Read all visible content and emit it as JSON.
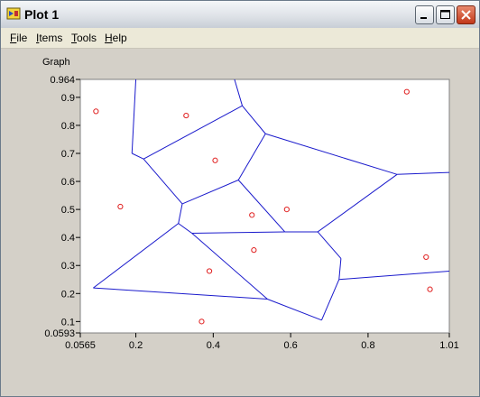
{
  "window": {
    "title": "Plot 1",
    "icon": "labview-vi-icon"
  },
  "menubar": [
    {
      "label": "File",
      "underline": "F",
      "rest": "ile"
    },
    {
      "label": "Items",
      "underline": "I",
      "rest": "tems"
    },
    {
      "label": "Tools",
      "underline": "T",
      "rest": "ools"
    },
    {
      "label": "Help",
      "underline": "H",
      "rest": "elp"
    }
  ],
  "graph": {
    "label": "Graph"
  },
  "colors": {
    "edges": "#1a1acc",
    "points": "#e02020",
    "plot_bg": "#ffffff"
  },
  "chart_data": {
    "type": "scatter",
    "title": "",
    "xlabel": "",
    "ylabel": "",
    "xlim": [
      0.0565,
      1.01
    ],
    "ylim": [
      0.0593,
      0.964
    ],
    "x_ticks": [
      "0.0565",
      "0.2",
      "0.4",
      "0.6",
      "0.8",
      "1.01"
    ],
    "x_tick_values": [
      0.0565,
      0.2,
      0.4,
      0.6,
      0.8,
      1.01
    ],
    "y_ticks": [
      "0.964",
      "0.9",
      "0.8",
      "0.7",
      "0.6",
      "0.5",
      "0.4",
      "0.3",
      "0.2",
      "0.1",
      "0.0593"
    ],
    "y_tick_values": [
      0.964,
      0.9,
      0.8,
      0.7,
      0.6,
      0.5,
      0.4,
      0.3,
      0.2,
      0.1,
      0.0593
    ],
    "grid": false,
    "series": [
      {
        "kind": "points",
        "x": [
          0.097,
          0.33,
          0.405,
          0.16,
          0.5,
          0.59,
          0.505,
          0.39,
          0.37,
          0.9,
          0.95,
          0.96
        ],
        "y": [
          0.85,
          0.835,
          0.675,
          0.51,
          0.48,
          0.5,
          0.355,
          0.28,
          0.1,
          0.92,
          0.33,
          0.215
        ]
      },
      {
        "kind": "voronoi-edges",
        "segments": [
          [
            [
              0.2,
              0.964
            ],
            [
              0.19,
              0.7
            ]
          ],
          [
            [
              0.19,
              0.7
            ],
            [
              0.22,
              0.68
            ]
          ],
          [
            [
              0.22,
              0.68
            ],
            [
              0.32,
              0.52
            ]
          ],
          [
            [
              0.32,
              0.52
            ],
            [
              0.31,
              0.45
            ]
          ],
          [
            [
              0.31,
              0.45
            ],
            [
              0.09,
              0.22
            ]
          ],
          [
            [
              0.09,
              0.22
            ],
            [
              0.54,
              0.18
            ]
          ],
          [
            [
              0.54,
              0.18
            ],
            [
              0.68,
              0.105
            ]
          ],
          [
            [
              0.68,
              0.105
            ],
            [
              0.725,
              0.25
            ]
          ],
          [
            [
              0.725,
              0.25
            ],
            [
              0.73,
              0.325
            ]
          ],
          [
            [
              0.73,
              0.325
            ],
            [
              0.67,
              0.42
            ]
          ],
          [
            [
              0.67,
              0.42
            ],
            [
              0.585,
              0.42
            ]
          ],
          [
            [
              0.585,
              0.42
            ],
            [
              0.345,
              0.415
            ]
          ],
          [
            [
              0.345,
              0.415
            ],
            [
              0.31,
              0.45
            ]
          ],
          [
            [
              0.345,
              0.415
            ],
            [
              0.54,
              0.18
            ]
          ],
          [
            [
              0.585,
              0.42
            ],
            [
              0.465,
              0.605
            ]
          ],
          [
            [
              0.465,
              0.605
            ],
            [
              0.32,
              0.52
            ]
          ],
          [
            [
              0.22,
              0.68
            ],
            [
              0.475,
              0.87
            ]
          ],
          [
            [
              0.475,
              0.87
            ],
            [
              0.535,
              0.77
            ]
          ],
          [
            [
              0.535,
              0.77
            ],
            [
              0.465,
              0.605
            ]
          ],
          [
            [
              0.475,
              0.87
            ],
            [
              0.455,
              0.964
            ]
          ],
          [
            [
              0.535,
              0.77
            ],
            [
              0.875,
              0.625
            ]
          ],
          [
            [
              0.875,
              0.625
            ],
            [
              0.67,
              0.42
            ]
          ],
          [
            [
              0.875,
              0.625
            ],
            [
              1.01,
              0.632
            ]
          ],
          [
            [
              0.725,
              0.25
            ],
            [
              1.01,
              0.28
            ]
          ]
        ]
      }
    ]
  }
}
